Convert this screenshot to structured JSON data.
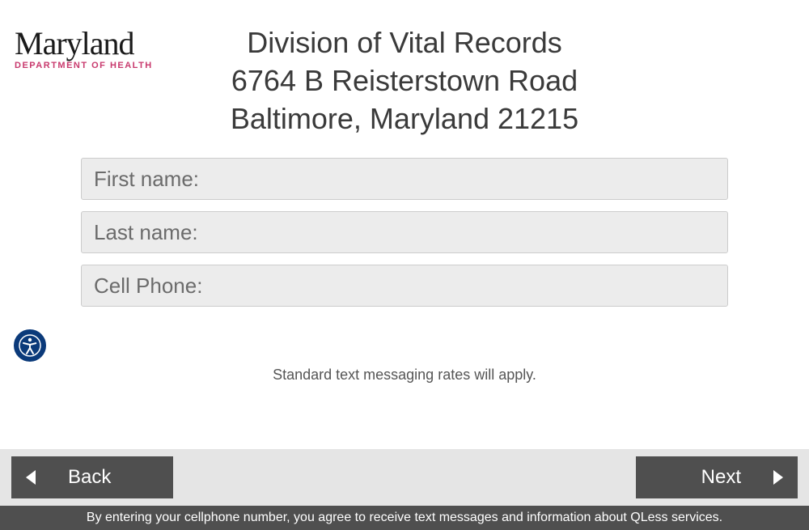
{
  "logo": {
    "main": "Maryland",
    "sub": "DEPARTMENT OF HEALTH"
  },
  "header": {
    "line1": "Division of Vital Records",
    "line2": "6764 B Reisterstown Road",
    "line3": "Baltimore, Maryland 21215"
  },
  "form": {
    "first_name_placeholder": "First name:",
    "last_name_placeholder": "Last name:",
    "cell_phone_placeholder": "Cell Phone:"
  },
  "disclaimer": "Standard text messaging rates will apply.",
  "buttons": {
    "back": "Back",
    "next": "Next"
  },
  "footer_notice": "By entering your cellphone number, you agree to receive text messages and information about QLess services."
}
